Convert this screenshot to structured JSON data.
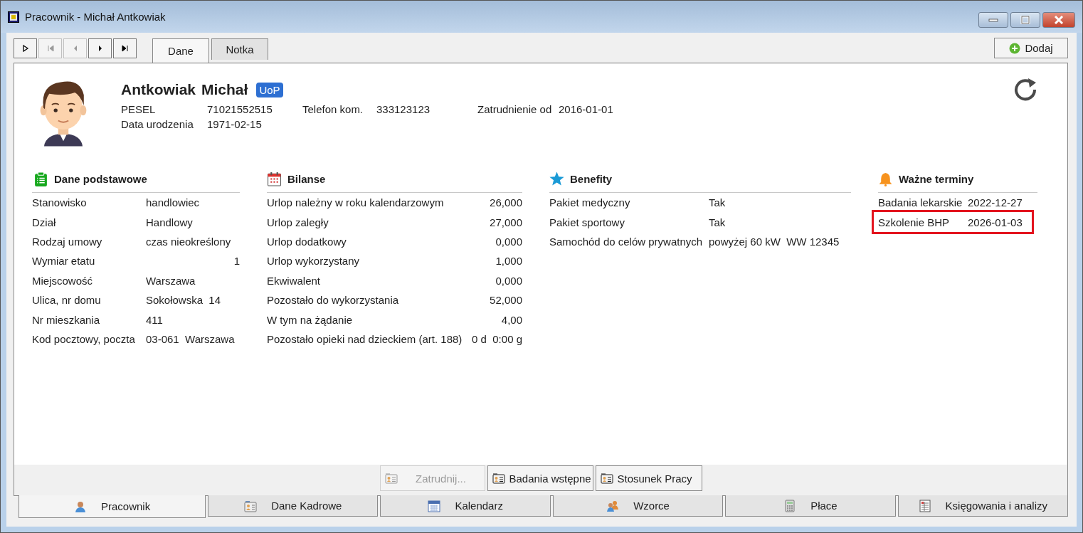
{
  "window": {
    "title": "Pracownik - Michał Antkowiak"
  },
  "nav_buttons": [
    {
      "kind": "new",
      "disabled": false
    },
    {
      "kind": "first",
      "disabled": true
    },
    {
      "kind": "prev",
      "disabled": true
    },
    {
      "kind": "next",
      "disabled": false
    },
    {
      "kind": "last",
      "disabled": false
    }
  ],
  "tabs": [
    {
      "label": "Dane",
      "selected": true
    },
    {
      "label": "Notka",
      "selected": false
    }
  ],
  "add_button": {
    "label": "Dodaj"
  },
  "employee": {
    "surname": "Antkowiak",
    "first_name": "Michał",
    "badge": "UoP",
    "fields": [
      {
        "label": "PESEL",
        "value": "71021552515"
      },
      {
        "label": "Telefon kom.",
        "value": "333123123"
      },
      {
        "label": "Zatrudnienie od",
        "value": "2016-01-01"
      },
      {
        "label": "Data urodzenia",
        "value": "1971-02-15"
      }
    ]
  },
  "sections": [
    {
      "kind": "clipboard",
      "title": "Dane podstawowe",
      "rows": [
        {
          "label": "Stanowisko",
          "value": "handlowiec",
          "numeric": false,
          "highlighted": false
        },
        {
          "label": "Dział",
          "value": "Handlowy",
          "numeric": false,
          "highlighted": false
        },
        {
          "label": "Rodzaj umowy",
          "value": "czas nieokreślony",
          "numeric": false,
          "highlighted": false
        },
        {
          "label": "Wymiar etatu",
          "value": "1",
          "numeric": true,
          "highlighted": false
        },
        {
          "label": "Miejscowość",
          "value": "Warszawa",
          "numeric": false,
          "highlighted": false
        },
        {
          "label": "Ulica, nr domu",
          "value": "Sokołowska  14",
          "numeric": false,
          "highlighted": false
        },
        {
          "label": "Nr mieszkania",
          "value": "411",
          "numeric": false,
          "highlighted": false
        },
        {
          "label": "Kod pocztowy, poczta",
          "value": "03-061  Warszawa",
          "numeric": false,
          "highlighted": false
        }
      ]
    },
    {
      "kind": "calendar",
      "title": "Bilanse",
      "rows": [
        {
          "label": "Urlop należny w roku kalendarzowym",
          "value": "26,000",
          "numeric": true,
          "highlighted": false
        },
        {
          "label": "Urlop zaległy",
          "value": "27,000",
          "numeric": true,
          "highlighted": false
        },
        {
          "label": "Urlop dodatkowy",
          "value": "0,000",
          "numeric": true,
          "highlighted": false
        },
        {
          "label": "Urlop wykorzystany",
          "value": "1,000",
          "numeric": true,
          "highlighted": false
        },
        {
          "label": "Ekwiwalent",
          "value": "0,000",
          "numeric": true,
          "highlighted": false
        },
        {
          "label": "Pozostało do wykorzystania",
          "value": "52,000",
          "numeric": true,
          "highlighted": false
        },
        {
          "label": "W tym na żądanie",
          "value": "4,00",
          "numeric": true,
          "highlighted": false
        },
        {
          "label": "Pozostało opieki nad dzieckiem (art. 188)",
          "value": "0 d  0:00 g",
          "numeric": true,
          "highlighted": false
        }
      ]
    },
    {
      "kind": "star",
      "title": "Benefity",
      "rows": [
        {
          "label": "Pakiet medyczny",
          "value": "Tak",
          "numeric": false,
          "highlighted": false
        },
        {
          "label": "Pakiet sportowy",
          "value": "Tak",
          "numeric": false,
          "highlighted": false
        },
        {
          "label": "Samochód do celów prywatnych",
          "value": "powyżej 60 kW  WW 12345",
          "numeric": false,
          "highlighted": false
        }
      ]
    },
    {
      "kind": "bell",
      "title": "Ważne terminy",
      "rows": [
        {
          "label": "Badania lekarskie",
          "value": "2022-12-27",
          "numeric": false,
          "highlighted": false
        },
        {
          "label": "Szkolenie BHP",
          "value": "2026-01-03",
          "numeric": false,
          "highlighted": true
        }
      ]
    }
  ],
  "action_buttons": [
    {
      "label": "Zatrudnij...",
      "disabled": true
    },
    {
      "label": "Badania wstępne",
      "disabled": false
    },
    {
      "label": "Stosunek Pracy",
      "disabled": false
    }
  ],
  "bottom_tabs": [
    {
      "kind": "person",
      "label": "Pracownik",
      "selected": true
    },
    {
      "kind": "card",
      "label": "Dane Kadrowe",
      "selected": false
    },
    {
      "kind": "calendar",
      "label": "Kalendarz",
      "selected": false
    },
    {
      "kind": "group",
      "label": "Wzorce",
      "selected": false
    },
    {
      "kind": "calculator",
      "label": "Płace",
      "selected": false
    },
    {
      "kind": "ledger",
      "label": "Księgowania i analizy",
      "selected": false
    }
  ]
}
